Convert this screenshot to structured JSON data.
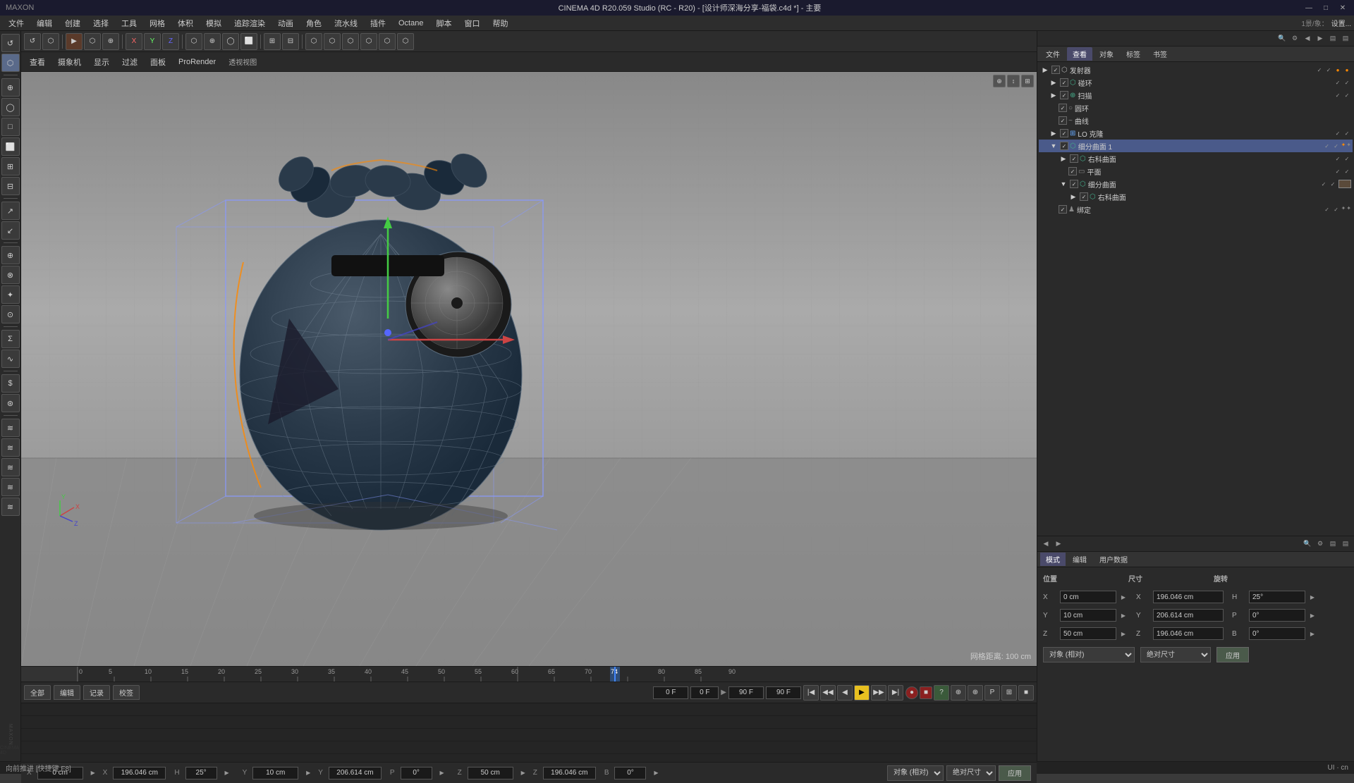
{
  "titlebar": {
    "title": "CINEMA 4D R20.059 Studio (RC - R20) - [设计师深海分享-福袋.c4d *] - 主要",
    "controls": [
      "—",
      "□",
      "✕"
    ]
  },
  "menubar": {
    "items": [
      "文件",
      "编辑",
      "创建",
      "选择",
      "工具",
      "网格",
      "体积",
      "模拟",
      "追踪渲染",
      "动画",
      "角色",
      "流水线",
      "插件",
      "Octane",
      "脚本",
      "窗口",
      "帮助"
    ]
  },
  "viewport": {
    "label": "透视视图",
    "grid_info": "网格距离: 100 cm",
    "tabs": [
      "查看",
      "摄象机",
      "显示",
      "过滤",
      "面板",
      "ProRender"
    ]
  },
  "scene_tree": {
    "header_tabs": [
      "文件",
      "查看",
      "对象",
      "标签",
      "书签"
    ],
    "items": [
      {
        "name": "发射器",
        "level": 0,
        "icon": "⬡",
        "color": "#888",
        "has_check": true
      },
      {
        "name": "碰环",
        "level": 1,
        "icon": "⬡",
        "color": "#4a8",
        "has_check": true
      },
      {
        "name": "扫描",
        "level": 1,
        "icon": "⊕",
        "color": "#4a8",
        "has_check": true
      },
      {
        "name": "圆环",
        "level": 2,
        "icon": "○",
        "color": "#888",
        "has_check": true
      },
      {
        "name": "曲线",
        "level": 2,
        "icon": "~",
        "color": "#888",
        "has_check": true
      },
      {
        "name": "LO 克隆",
        "level": 1,
        "icon": "⊞",
        "color": "#6af",
        "has_check": true
      },
      {
        "name": "细分曲面 1",
        "level": 1,
        "icon": "⬡",
        "color": "#4a8",
        "has_check": true
      },
      {
        "name": "右科曲面",
        "level": 2,
        "icon": "⬡",
        "color": "#4a8",
        "has_check": true
      },
      {
        "name": "平面",
        "level": 3,
        "icon": "▭",
        "color": "#888",
        "has_check": true
      },
      {
        "name": "细分曲面",
        "level": 2,
        "icon": "⬡",
        "color": "#4a8",
        "has_check": true
      },
      {
        "name": "右科曲面",
        "level": 3,
        "icon": "⬡",
        "color": "#4a8",
        "has_check": true
      },
      {
        "name": "绑定",
        "level": 2,
        "icon": "♟",
        "color": "#888",
        "has_check": true
      }
    ]
  },
  "attributes": {
    "header_tabs": [
      "模式",
      "编辑",
      "用户数据"
    ],
    "section_headers": [
      "位置",
      "尺寸",
      "旋转"
    ],
    "position": {
      "x": "0 cm",
      "y": "10 cm",
      "z": "50 cm"
    },
    "size": {
      "x": "196.046 cm",
      "y": "206.614 cm",
      "z": "196.046 cm"
    },
    "rotation": {
      "h": "25°",
      "p": "0°",
      "b": "0°"
    },
    "coord_mode": "对象 (相对)",
    "size_mode": "绝对尺寸",
    "apply_btn": "应用"
  },
  "timeline": {
    "frame_start": "0 F",
    "frame_current": "0 F",
    "frame_end": "90 F",
    "fps": "90 F",
    "playhead_frame": "74 F",
    "ruler_marks": [
      "0",
      "5",
      "10",
      "15",
      "20",
      "25",
      "30",
      "35",
      "40",
      "45",
      "50",
      "55",
      "60",
      "65",
      "70",
      "75",
      "80",
      "85",
      "90"
    ],
    "track_tabs": [
      "全部",
      "编辑",
      "记录",
      "校签"
    ]
  },
  "statusbar": {
    "left": "向前推进 [快捷键 F8]",
    "right_icon": "UI · cn"
  },
  "left_toolbar": {
    "groups": [
      [
        "↺",
        "↔"
      ],
      [
        "⬡",
        "⊕",
        "◯",
        "⬜",
        "⊞",
        "⊟"
      ],
      [
        "↗",
        "↙"
      ],
      [
        "⊕",
        "⊗",
        "✦",
        "⊙"
      ],
      [
        "Σ",
        "∿"
      ],
      [
        "$",
        "⊛"
      ],
      [
        "≋",
        "≋",
        "≋",
        "≋",
        "≋"
      ]
    ]
  },
  "top_toolbar": {
    "buttons": [
      "↺",
      "⬡",
      "⊕",
      "○",
      "□",
      "X",
      "Y",
      "Z",
      "⬡",
      "⬡",
      "⬡",
      "⬡",
      "⬡",
      "⬡",
      "⬡",
      "⬡",
      "⬡",
      "⬡",
      "⬡",
      "⬡"
    ]
  }
}
